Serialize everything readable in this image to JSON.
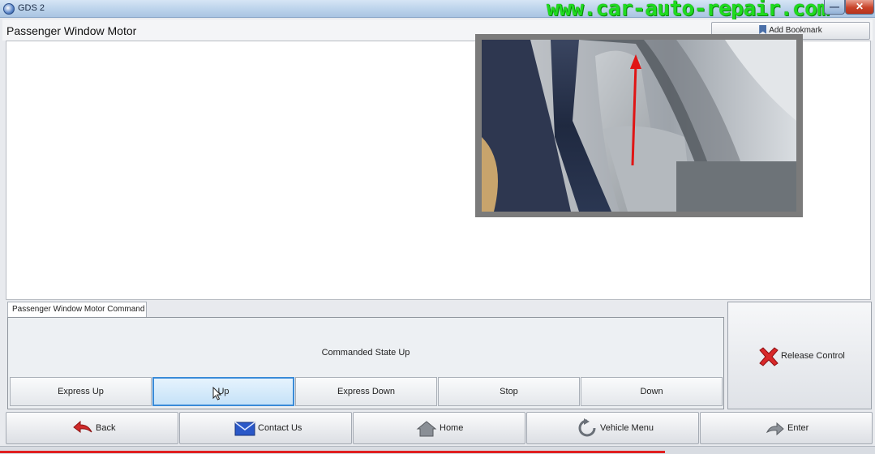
{
  "window": {
    "title": "GDS 2",
    "watermark": "www.car-auto-repair.com"
  },
  "header": {
    "title": "Passenger Window Motor",
    "bookmark_label": "Add Bookmark"
  },
  "command": {
    "tab_label": "Passenger Window Motor Command",
    "state_text": "Commanded State Up",
    "buttons": [
      "Express Up",
      "Up",
      "Express Down",
      "Stop",
      "Down"
    ],
    "selected": "Up",
    "release_label": "Release Control"
  },
  "nav": {
    "back": "Back",
    "contact": "Contact Us",
    "home": "Home",
    "vehicle_menu": "Vehicle Menu",
    "enter": "Enter"
  },
  "colors": {
    "accent": "#3a8bd8",
    "arrow": "#e01515",
    "watermark": "#1fdb1f"
  }
}
